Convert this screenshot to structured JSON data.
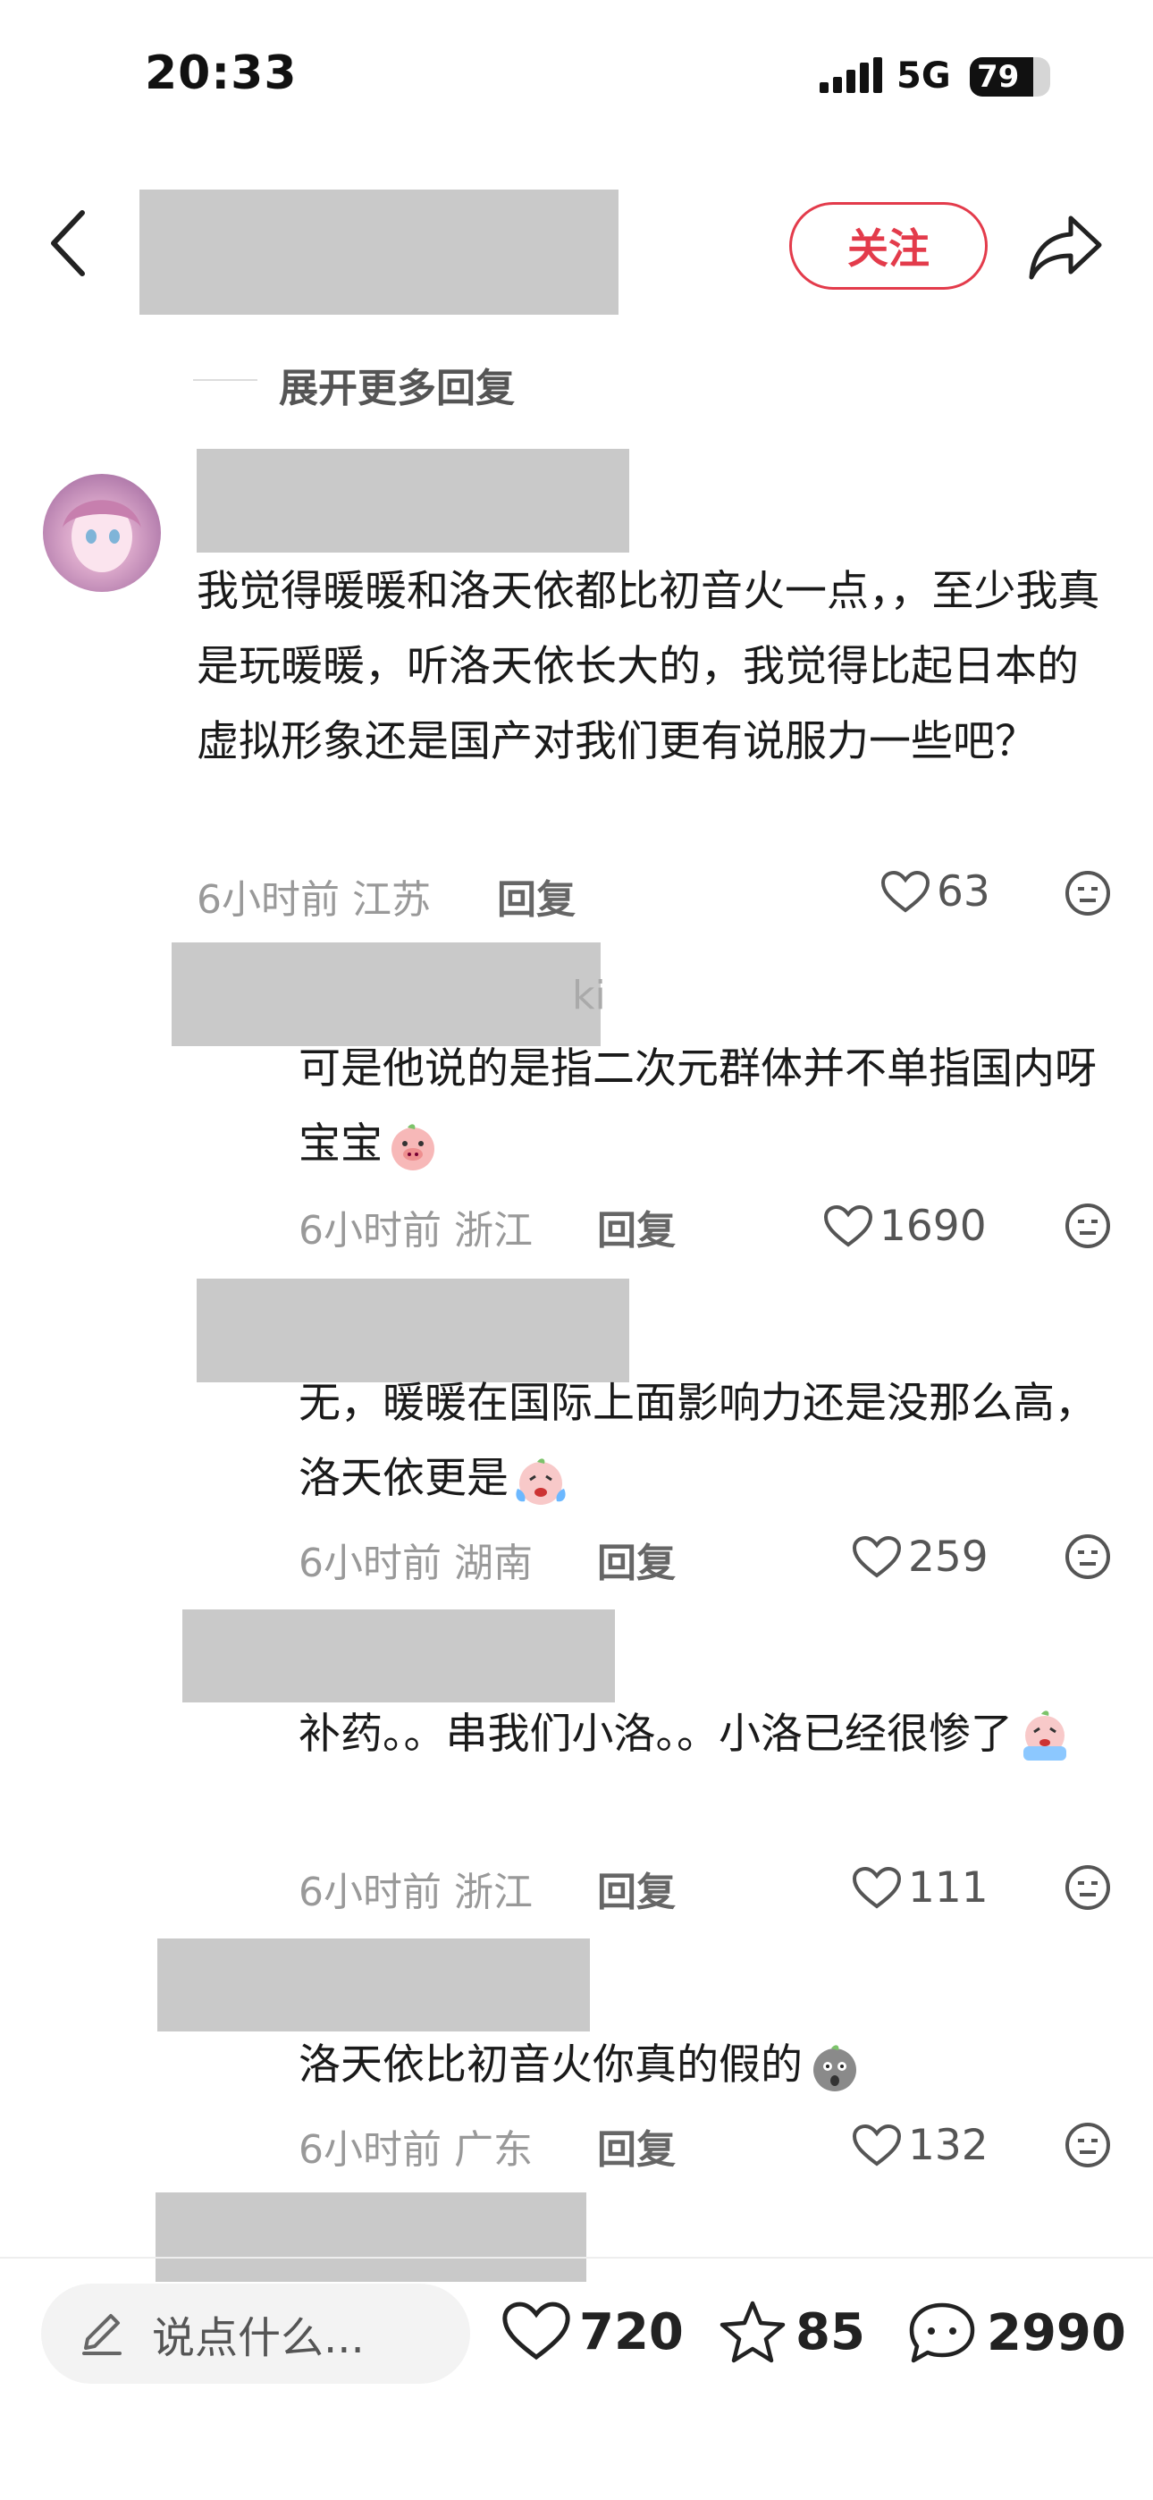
{
  "status_bar": {
    "time": "20:33",
    "network": "5G",
    "battery": "79",
    "battery_level": 0.79
  },
  "header": {
    "follow_label": "关注"
  },
  "expand_more": "展开更多回复",
  "comments": [
    {
      "text": "我觉得暖暖和洛天依都比初音火一点，，至少我真是玩暖暖，听洛天依长大的，我觉得比起日本的虚拟形象还是国产对我们更有说服力一些吧？",
      "time": "6小时前",
      "location": "江苏",
      "reply_label": "回复",
      "likes": "63"
    },
    {
      "username_fragment": "ki",
      "text": "可是他说的是指二次元群体并不单指国内呀宝宝",
      "emoji": "pig-face",
      "time": "6小时前",
      "location": "浙江",
      "reply_label": "回复",
      "likes": "1690"
    },
    {
      "text": "无，暖暖在国际上面影响力还是没那么高，洛天依更是",
      "emoji": "crying-face",
      "time": "6小时前",
      "location": "湖南",
      "reply_label": "回复",
      "likes": "259"
    },
    {
      "text": "补药。。串我们小洛。。小洛已经很惨了",
      "emoji": "sobbing-face",
      "time": "6小时前",
      "location": "浙江",
      "reply_label": "回复",
      "likes": "111"
    },
    {
      "text": "洛天依比初音火你真的假的",
      "emoji": "shocked-face",
      "time": "6小时前",
      "location": "广东",
      "reply_label": "回复",
      "likes": "132"
    }
  ],
  "bottom_bar": {
    "input_placeholder": "说点什么...",
    "likes": "720",
    "favorites": "85",
    "comments": "2990"
  }
}
